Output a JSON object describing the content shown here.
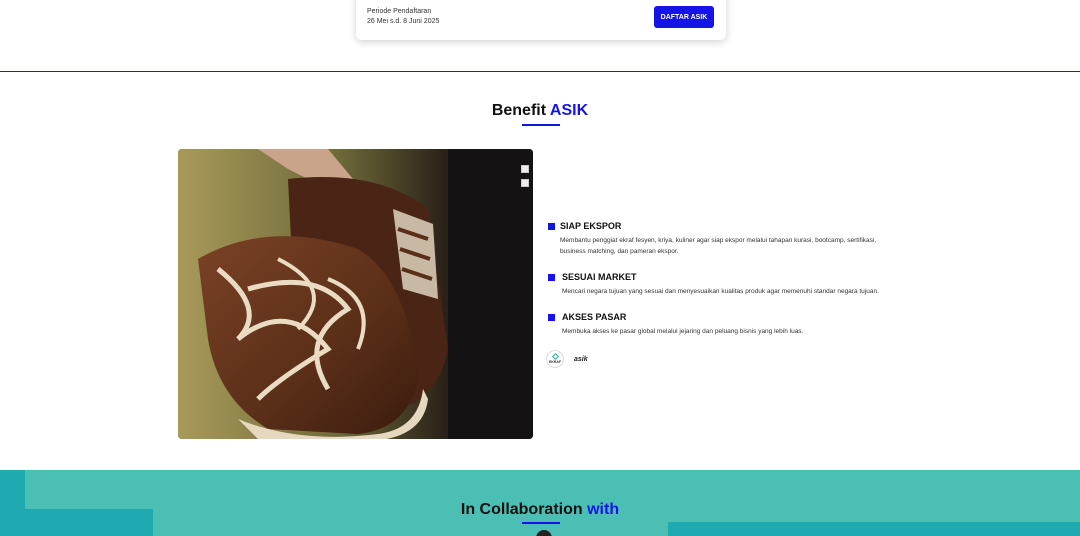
{
  "registration": {
    "period_label": "Periode Pendaftaran",
    "period_dates": "26 Mei s.d. 8 Juni 2025",
    "cta_label": "DAFTAR ASIK"
  },
  "benefit": {
    "title_main": "Benefit",
    "title_accent": "ASIK",
    "items": [
      {
        "title": "SIAP EKSPOR",
        "description": "Membantu penggiat ekraf fesyen, kriya, kuliner agar siap ekspor melalui tahapan kurasi, bootcamp, sertifikasi, business matching, dan pameran ekspor."
      },
      {
        "title": "SESUAI MARKET",
        "description": "Mencari negara tujuan yang sesuai dan menyesuaikan kualitas produk agar memenuhi standar negara tujuan."
      },
      {
        "title": "AKSES PASAR",
        "description": "Membuka akses ke pasar global melalui jejaring dan peluang bisnis yang lebih luas."
      }
    ],
    "logos": {
      "ekraf": "EKRAF",
      "asik": "asik"
    },
    "accent_color": "#1414e6"
  },
  "collaboration": {
    "title_main": "In Collaboration",
    "title_accent": "with",
    "background_color": "#4cbfb5"
  }
}
